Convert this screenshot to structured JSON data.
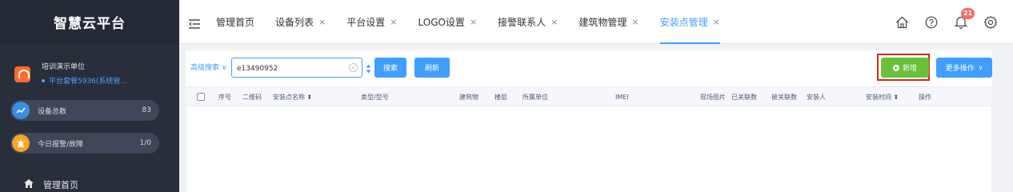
{
  "sidebar": {
    "brand": "智慧云平台",
    "org": {
      "name": "培训演示单位",
      "plan": "平台套餐5936(系统管..."
    },
    "stats": [
      {
        "label": "设备总数",
        "value": "83"
      },
      {
        "label": "今日报警/故障",
        "value": "1/0"
      }
    ],
    "menu": {
      "home": "管理首页"
    }
  },
  "tabs": [
    {
      "label": "管理首页"
    },
    {
      "label": "设备列表",
      "close": "×"
    },
    {
      "label": "平台设置",
      "close": "×"
    },
    {
      "label": "LOGO设置",
      "close": "×"
    },
    {
      "label": "接警联系人",
      "close": "×"
    },
    {
      "label": "建筑物管理",
      "close": "×"
    },
    {
      "label": "安装点管理",
      "close": "×"
    }
  ],
  "header": {
    "notification_count": "21"
  },
  "toolbar": {
    "advanced_search": "高级搜索",
    "search_value": "e13490952",
    "search_button": "搜索",
    "refresh_button": "刷新",
    "add_button": "新增",
    "more_button": "更多操作"
  },
  "table": {
    "columns": [
      "序号",
      "二维码",
      "安装点名称",
      "类型/型号",
      "建筑物",
      "楼层",
      "所属单位",
      "IMEI",
      "现场图片",
      "已关联数",
      "被关联数",
      "安装人",
      "安装时间",
      "操作"
    ]
  },
  "colors": {
    "primary": "#409eff",
    "success": "#67c23a",
    "sidebar": "#282e3a",
    "alert": "#f56c6c"
  }
}
